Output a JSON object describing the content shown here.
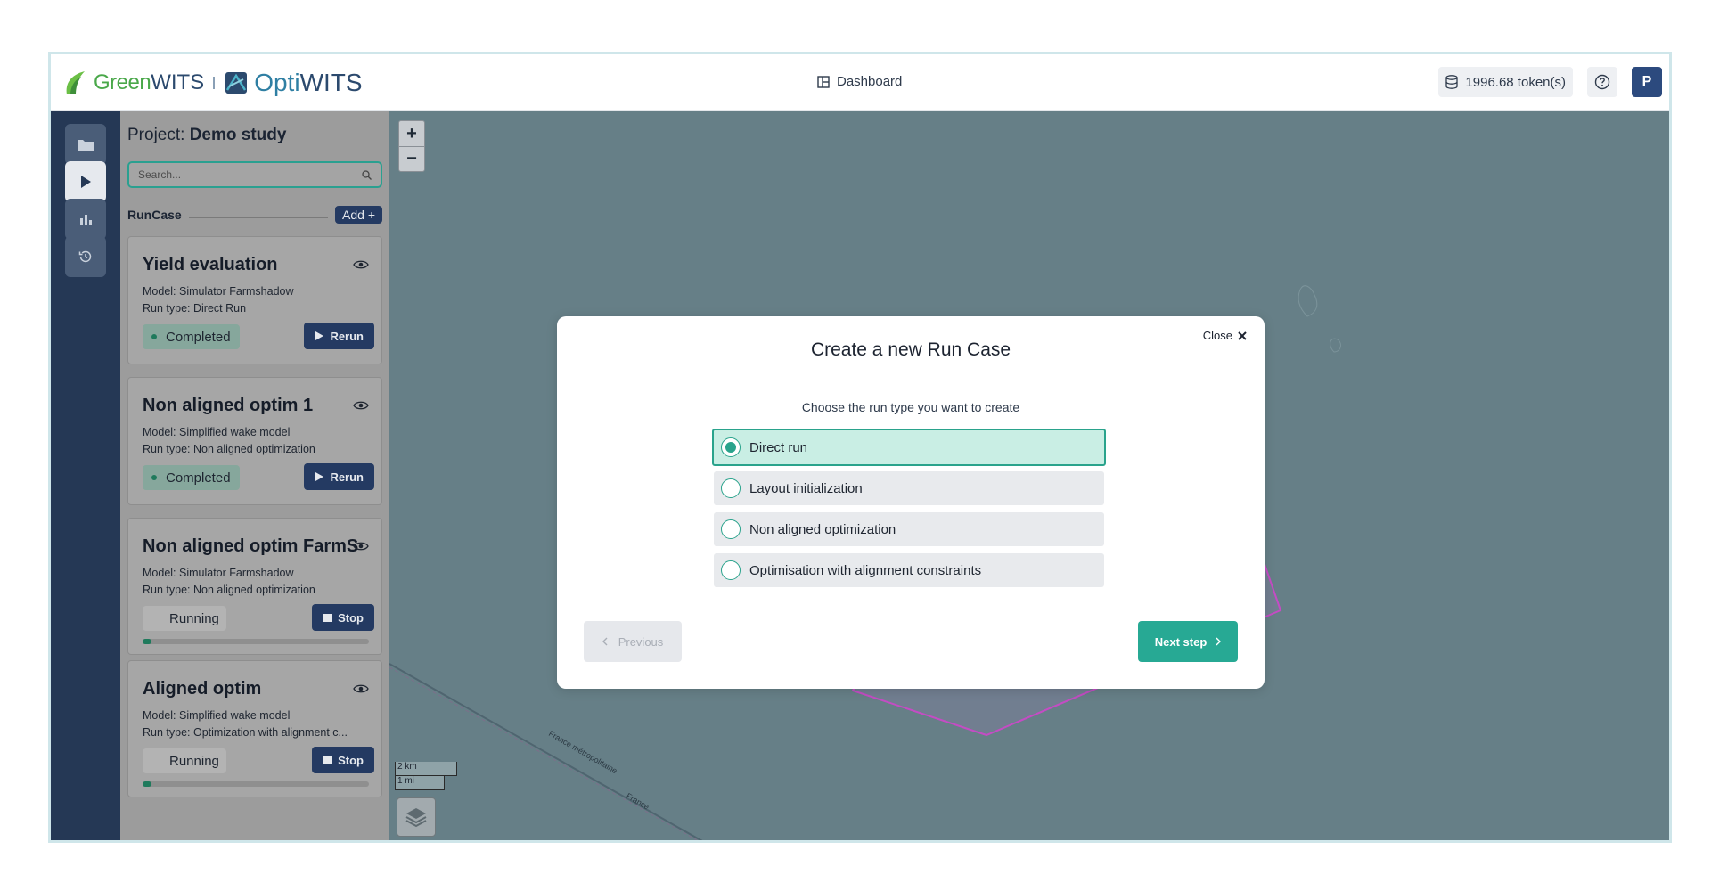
{
  "header": {
    "logo_greenwits_prefix": "Green",
    "logo_greenwits_suffix": "WITS",
    "logo_opti_prefix": "Opti",
    "logo_opti_suffix": "WITS",
    "dashboard_label": "Dashboard",
    "tokens_label": "1996.68 token(s)",
    "help_icon": "help-circle-icon",
    "avatar_initial": "P"
  },
  "rail": {
    "items": [
      {
        "icon": "folder-icon",
        "active": false
      },
      {
        "icon": "play-icon",
        "active": true
      },
      {
        "icon": "bar-chart-icon",
        "active": false
      },
      {
        "icon": "history-icon",
        "active": false
      }
    ]
  },
  "panel": {
    "project_prefix": "Project: ",
    "project_name": "Demo study",
    "search_placeholder": "Search...",
    "runcase_label": "RunCase",
    "add_label": "Add +",
    "cards": [
      {
        "title": "Yield evaluation",
        "model": "Model: Simulator Farmshadow",
        "run_type": "Run type: Direct Run",
        "status": "Completed",
        "action": "Rerun"
      },
      {
        "title": "Non aligned optim 1",
        "model": "Model: Simplified wake model",
        "run_type": "Run type: Non aligned optimization",
        "status": "Completed",
        "action": "Rerun"
      },
      {
        "title": "Non aligned optim FarmS",
        "model": "Model: Simulator Farmshadow",
        "run_type": "Run type: Non aligned optimization",
        "status": "Running",
        "action": "Stop",
        "progress": 0.04
      },
      {
        "title": "Aligned optim",
        "model": "Model: Simplified wake model",
        "run_type": "Run type: Optimization with alignment c...",
        "status": "Running",
        "action": "Stop",
        "progress": 0.04
      }
    ]
  },
  "map": {
    "zoom_in": "+",
    "zoom_out": "−",
    "scale_km": "2 km",
    "scale_mi": "1 mi",
    "border_label_1": "France métropolitaine",
    "border_label_2": "France",
    "layers_icon": "layers-icon"
  },
  "modal": {
    "title": "Create a new Run Case",
    "close_label": "Close",
    "subtitle": "Choose the run type you want to create",
    "options": [
      {
        "label": "Direct run",
        "selected": true
      },
      {
        "label": "Layout initialization",
        "selected": false
      },
      {
        "label": "Non aligned optimization",
        "selected": false
      },
      {
        "label": "Optimisation with alignment constraints",
        "selected": false
      }
    ],
    "previous_label": "Previous",
    "next_label": "Next step"
  },
  "colors": {
    "brand_navy": "#243a62",
    "accent_teal": "#27a994",
    "map_water": "#667f87",
    "polygon_stroke": "#c44cc4"
  }
}
